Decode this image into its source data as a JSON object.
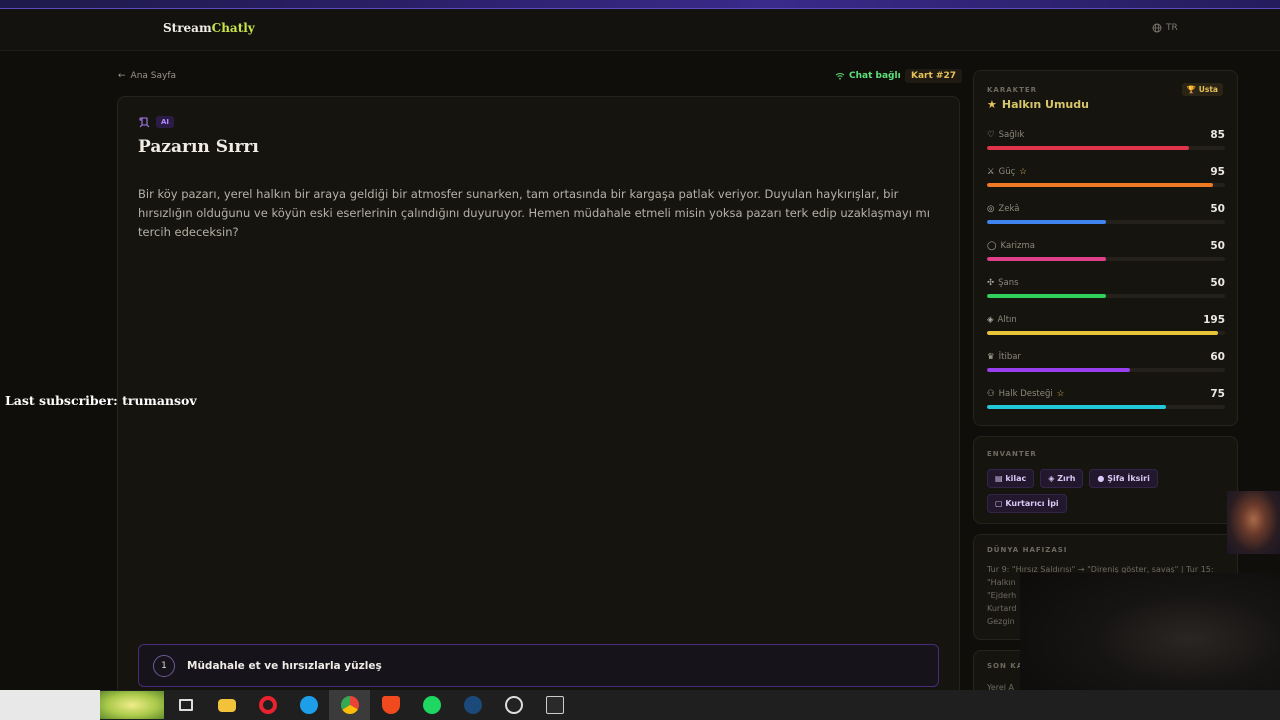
{
  "brand": {
    "part1": "Stream",
    "part2": "Chatly"
  },
  "lang": "TR",
  "nav": {
    "back_label": "Ana Sayfa",
    "chat_status": "Chat bağlı",
    "card_badge": "Kart #27"
  },
  "story": {
    "ai_tag": "AI",
    "title": "Pazarın Sırrı",
    "text": "Bir köy pazarı, yerel halkın bir araya geldiği bir atmosfer sunarken, tam ortasında bir kargaşa patlak veriyor. Duyulan haykırışlar, bir hırsızlığın olduğunu ve köyün eski eserlerinin çalındığını duyuruyor. Hemen müdahale etmeli misin yoksa pazarı terk edip uzaklaşmayı mı tercih edeceksin?",
    "choices": [
      {
        "num": "1",
        "label": "Müdahale et ve hırsızlarla yüzleş"
      }
    ]
  },
  "character": {
    "section_title": "KARAKTER",
    "name": "Halkın Umudu",
    "rank": "Usta",
    "stats": [
      {
        "name": "Sağlık",
        "value": "85",
        "pct": 0.85,
        "color": "#e0344a",
        "icon": "heart-icon"
      },
      {
        "name": "Güç",
        "value": "95",
        "pct": 0.95,
        "color": "#f07a24",
        "icon": "sword-icon"
      },
      {
        "name": "Zekâ",
        "value": "50",
        "pct": 0.5,
        "color": "#3f84f0",
        "icon": "brain-icon"
      },
      {
        "name": "Karizma",
        "value": "50",
        "pct": 0.5,
        "color": "#e0408a",
        "icon": "chat-bubble-icon"
      },
      {
        "name": "Şans",
        "value": "50",
        "pct": 0.5,
        "color": "#2fcf5a",
        "icon": "clover-icon"
      },
      {
        "name": "Altın",
        "value": "195",
        "pct": 0.97,
        "color": "#e8c43a",
        "icon": "coin-icon"
      },
      {
        "name": "İtibar",
        "value": "60",
        "pct": 0.6,
        "color": "#9a3ff0",
        "icon": "crown-icon"
      },
      {
        "name": "Halk Desteği",
        "value": "75",
        "pct": 0.75,
        "color": "#22c7d8",
        "icon": "people-icon"
      }
    ]
  },
  "inventory": {
    "section_title": "ENVANTER",
    "items": [
      "kilac",
      "Zırh",
      "Şifa İksiri",
      "Kurtarıcı İpi"
    ]
  },
  "memory": {
    "section_title": "DÜNYA HAFIZASI",
    "text_lines": [
      "Tur 9: \"Hırsız Saldırısı\" → \"Direniş göster, savaş\" | Tur 15:",
      "\"Halkın",
      "\"Ejderh",
      "Kurtard",
      "Gezgin"
    ]
  },
  "last": {
    "section_title": "SON KA",
    "text": "Yerel A"
  },
  "overlay": {
    "last_subscriber": "Last subscriber: trumansov"
  }
}
